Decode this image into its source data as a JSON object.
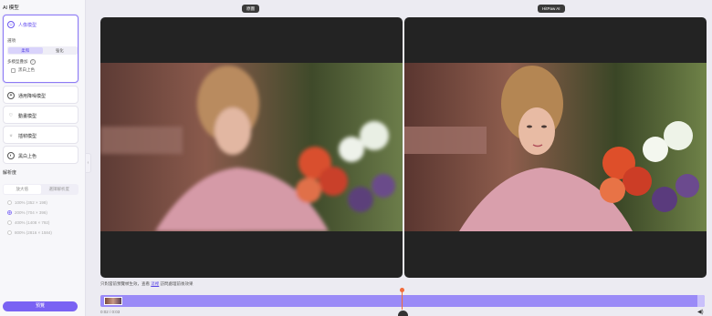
{
  "sidebar": {
    "title": "AI 模型",
    "models": [
      {
        "id": "portrait",
        "label": "人像模型",
        "icon": "face-icon"
      },
      {
        "id": "general",
        "label": "通用降噪模型",
        "icon": "sparkle-icon"
      },
      {
        "id": "animation",
        "label": "動畫模型",
        "icon": "heart-icon"
      },
      {
        "id": "frame",
        "label": "插幀模型",
        "icon": "sun-icon"
      },
      {
        "id": "colorize",
        "label": "黑白上色",
        "icon": "palette-icon"
      }
    ],
    "portrait_options": {
      "select_label": "選項",
      "segments": [
        "柔和",
        "強化"
      ],
      "selected_segment": "柔和",
      "model_label": "多模型疊加",
      "checkbox_label": "黑白上色"
    },
    "resolution": {
      "title": "解析度",
      "tabs": [
        "放大倍",
        "選擇解析度"
      ],
      "active_tab": "放大倍",
      "options": [
        "100% (352 × 198)",
        "200% (704 × 396)",
        "400% (1408 × 792)",
        "800% (2816 × 1584)"
      ],
      "selected_index": 1
    },
    "generate_label": "預覽",
    "accent_color": "#7a63f3"
  },
  "main": {
    "left_label": "原圖",
    "right_label": "HitPaw AI",
    "hint_prefix": "只對當前預覽幀生效，查看",
    "hint_link": "這裡",
    "hint_suffix": "訪問處理前後效果",
    "time": "0:02 / 0:03",
    "playhead_color": "#f26b3a"
  }
}
